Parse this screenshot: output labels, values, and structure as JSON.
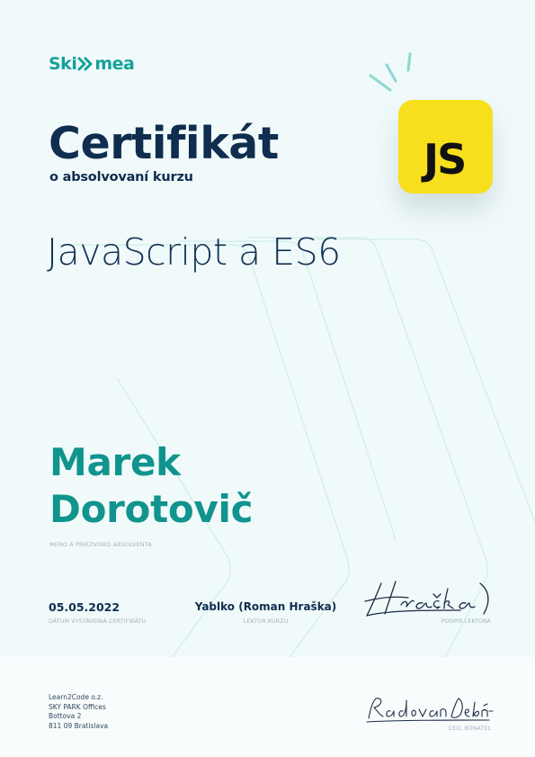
{
  "brand": {
    "name_part_a": "Ski",
    "name_part_b": "mea",
    "accent_color": "#14a19a"
  },
  "certificate": {
    "title": "Certifikát",
    "subtitle": "o absolvovaní kurzu",
    "course_name": "JavaScript a ES6",
    "badge_text": "JS",
    "badge_color": "#f7df1e"
  },
  "graduate": {
    "name": "Marek Dorotovič",
    "caption": "MENO A PRIEZVISKO ABSOLVENTA"
  },
  "issue": {
    "date": "05.05.2022",
    "date_caption": "DÁTUM VYSTÁVENIA CERTIFIKÁTU"
  },
  "lecturer": {
    "name": "Yablko (Roman Hraška)",
    "caption": "LEKTOR KURZU",
    "signature_text": "Hraška)",
    "signature_caption": "PODPIS LEKTORA"
  },
  "issuer": {
    "address_lines": [
      "Learn2Code o.z.",
      "SKY PARK Offices",
      "Bottova 2",
      "811 09 Bratislava"
    ],
    "ceo_signature_text": "Radovan Debnár",
    "ceo_caption": "CEO, KONATEĽ"
  },
  "icons": {
    "logo_chevron": "double-chevron-icon",
    "sparkle": "sparkle-lines-icon"
  }
}
